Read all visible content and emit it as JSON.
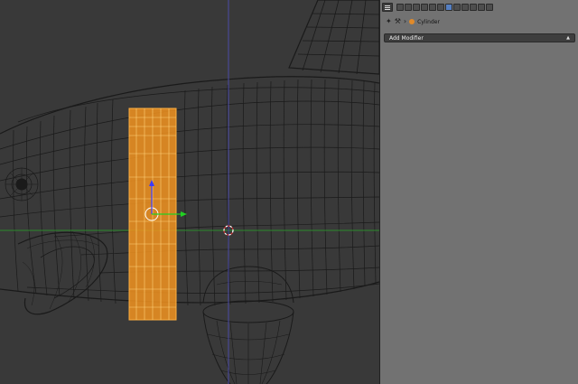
{
  "viewport": {
    "background": "#393939",
    "wire_color": "#111111",
    "selection_color": "#f29320",
    "x_axis_color": "#2c8a2c",
    "z_axis_color": "#4a4aa8"
  },
  "properties": {
    "header_icons": [
      "render-icon",
      "render-layers-icon",
      "scene-icon",
      "world-icon",
      "object-icon",
      "constraints-icon",
      "modifiers-icon",
      "data-icon",
      "material-icon",
      "texture-icon",
      "particles-icon",
      "physics-icon"
    ],
    "active_tab": "modifiers-icon",
    "context": {
      "pin_icon": "pin-icon",
      "wrench_icon": "wrench-icon",
      "object_name": "Cylinder"
    },
    "add_modifier_label": "Add Modifier"
  }
}
